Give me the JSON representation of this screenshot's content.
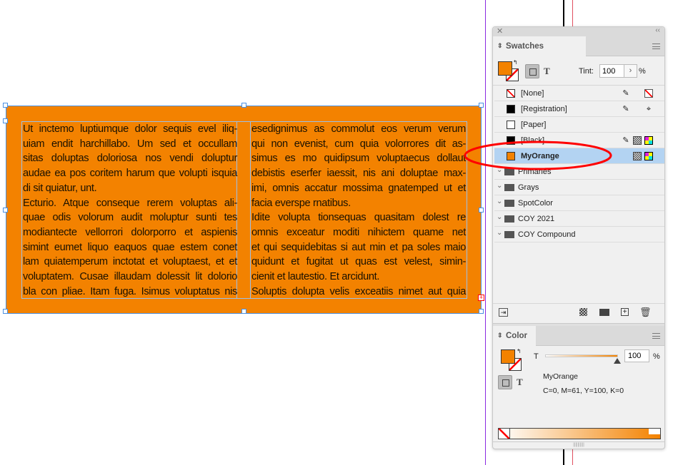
{
  "document": {
    "column1": [
      "Ut inctemo luptiumque dolor sequis evel iliq-",
      "uiam endit harchillabo. Um sed et occullam",
      "sitas doluptas doloriosa nos vendi doluptur",
      "audae ea pos coritem harum que volupti isquia",
      "di sit quiatur, unt.",
      "Ecturio. Atque conseque rerem voluptas ali-",
      "quae odis volorum audit moluptur sunti tes",
      "modiantecte vellorrori dolorporro et aspienis",
      "simint eumet liquo eaquos quae estem conet",
      "lam quiatemperum inctotat et voluptaest, et et",
      "voluptatem. Cusae illaudam dolessit lit dolorio",
      "bla con pliae. Itam fuga. Isimus voluptatus nis"
    ],
    "column2": [
      "esedignimus as commolut eos verum verum",
      "qui non evenist, cum quia volorrores dit as-",
      "simus es mo quidipsum voluptaecus dollaut",
      "debistis eserfer iaessit, nis ani doluptae max-",
      "imi, omnis accatur mossima gnatemped ut et",
      "facia everspe rnatibus.",
      "Idite volupta tionsequas quasitam dolest re",
      "omnis exceatur moditi nihictem quame net",
      "et qui sequidebitas si aut min et pa soles maio",
      "quidunt et fugitat ut quas est velest, simin-",
      "cienit et lautestio. Et arcidunt.",
      "Soluptis dolupta velis exceatiis nimet aut quia"
    ],
    "fill_color": "#f38200"
  },
  "swatches": {
    "tab": "Swatches",
    "tint_label": "Tint:",
    "tint_value": "100",
    "percent": "%",
    "text_toggle": "T",
    "items": [
      {
        "name": "[None]",
        "color": "none"
      },
      {
        "name": "[Registration]",
        "color": "#000000"
      },
      {
        "name": "[Paper]",
        "color": "#ffffff"
      },
      {
        "name": "[Black]",
        "color": "#000000"
      },
      {
        "name": "MyOrange",
        "color": "#f38200",
        "selected": true
      }
    ],
    "groups": [
      "Primaries",
      "Grays",
      "SpotColor",
      "COY 2021",
      "COY Compound"
    ]
  },
  "color": {
    "tab": "Color",
    "t_label": "T",
    "tint_value": "100",
    "percent": "%",
    "swatch_name": "MyOrange",
    "values": "C=0, M=61, Y=100, K=0",
    "text_toggle": "T"
  },
  "colors": {
    "accent": "#f38200",
    "selection": "#b3d3f2",
    "annotation": "#ff0000"
  }
}
